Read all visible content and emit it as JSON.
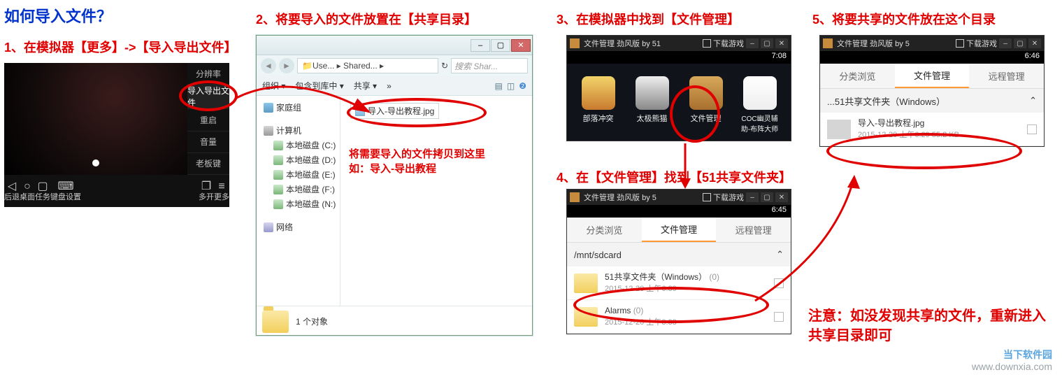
{
  "title": "如何导入文件？",
  "steps": {
    "s1": "1、在模拟器【更多】->【导入导出文件】",
    "s2": "2、将要导入的文件放置在【共享目录】",
    "s3": "3、在模拟器中找到【文件管理】",
    "s4": "4、在【文件管理】找到【51共享文件夹】",
    "s5": "5、将要共享的文件放在这个目录"
  },
  "emulator": {
    "menu": {
      "resolution": "分辨率",
      "import_export": "导入导出文件",
      "restart": "重启",
      "volume": "音量",
      "boss": "老板键"
    },
    "dock": {
      "back": "后退",
      "desktop": "桌面",
      "tasks": "任务",
      "keyboard": "键盘设置",
      "multi": "多开",
      "more": "更多"
    }
  },
  "explorer": {
    "path_text": "Use... ▸ Shared...  ▸",
    "search_placeholder": "搜索 Shar...",
    "toolbar": {
      "organize": "组织 ▾",
      "include": "包含到库中 ▾",
      "share": "共享 ▾",
      "more": "»"
    },
    "tree": {
      "home_group": "家庭组",
      "computer": "计算机",
      "disk_c": "本地磁盘 (C:)",
      "disk_d": "本地磁盘 (D:)",
      "disk_e": "本地磁盘 (E:)",
      "disk_f": "本地磁盘 (F:)",
      "disk_n": "本地磁盘 (N:)",
      "network": "网络"
    },
    "file": "导入-导出教程.jpg",
    "note1": "将需要导入的文件拷贝到这里",
    "note2": "如：导入-导出教程",
    "footer": "1 个对象"
  },
  "phone3": {
    "title": "文件管理  劲风版 by 51",
    "download": "下载游戏",
    "time": "7:08",
    "apps": {
      "a1": "部落冲突",
      "a2": "太极熊猫",
      "a3": "文件管理",
      "a4": "COC幽灵辅助-布阵大师"
    }
  },
  "phone4": {
    "title": "文件管理  劲风版 by 5",
    "download": "下载游戏",
    "time": "6:45",
    "tabs": {
      "t1": "分类浏览",
      "t2": "文件管理",
      "t3": "远程管理"
    },
    "path": "/mnt/sdcard",
    "item1": {
      "name": "51共享文件夹（Windows）",
      "count": "(0)",
      "meta": "2015-12-20 上午6:39"
    },
    "item2": {
      "name": "Alarms",
      "count": "(0)",
      "meta": "2015-12-20 上午3:33"
    }
  },
  "phone5": {
    "title": "文件管理  劲风版 by 5",
    "download": "下载游戏",
    "time": "6:46",
    "tabs": {
      "t1": "分类浏览",
      "t2": "文件管理",
      "t3": "远程管理"
    },
    "path": "...51共享文件夹（Windows）",
    "item": {
      "name": "导入-导出教程.jpg",
      "meta": "2015-12-20 上午6:29  55.2 KB"
    }
  },
  "note": "注意：如没发现共享的文件，重新进入共享目录即可",
  "watermark": {
    "cn": "当下软件园",
    "url": "www.downxia.com"
  }
}
